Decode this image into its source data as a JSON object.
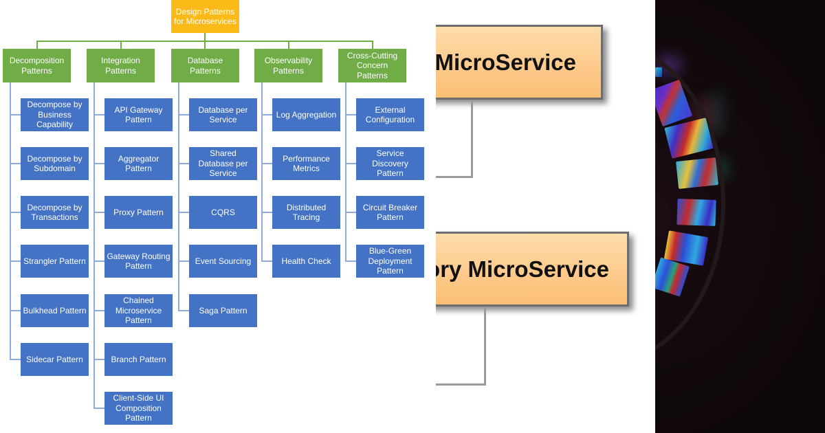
{
  "diagram": {
    "root": "Design Patterns for Microservices",
    "categories": [
      {
        "label": "Decomposition Patterns",
        "items": [
          "Decompose by Business Capability",
          "Decompose by Subdomain",
          "Decompose by Transactions",
          "Strangler Pattern",
          "Bulkhead Pattern",
          "Sidecar Pattern"
        ]
      },
      {
        "label": "Integration Patterns",
        "items": [
          "API Gateway Pattern",
          "Aggregator Pattern",
          "Proxy Pattern",
          "Gateway Routing Pattern",
          "Chained Microservice Pattern",
          "Branch Pattern",
          "Client-Side UI Composition Pattern"
        ]
      },
      {
        "label": "Database Patterns",
        "items": [
          "Database per Service",
          "Shared Database per Service",
          "CQRS",
          "Event Sourcing",
          "Saga Pattern"
        ]
      },
      {
        "label": "Observability Patterns",
        "items": [
          "Log Aggregation",
          "Performance Metrics",
          "Distributed Tracing",
          "Health Check"
        ]
      },
      {
        "label": "Cross-Cutting Concern Patterns",
        "items": [
          "External Configuration",
          "Service Discovery Pattern",
          "Circuit Breaker Pattern",
          "Blue-Green Deployment Pattern"
        ]
      }
    ]
  },
  "overlay": {
    "box_top": "MicroService",
    "box_bottom": "ory MicroService"
  },
  "colors": {
    "root": "#fbba18",
    "category": "#70ad47",
    "item": "#4472c4",
    "overlay_box": "#fdc98a"
  },
  "photo": {
    "subject": "stained-glass-window"
  }
}
